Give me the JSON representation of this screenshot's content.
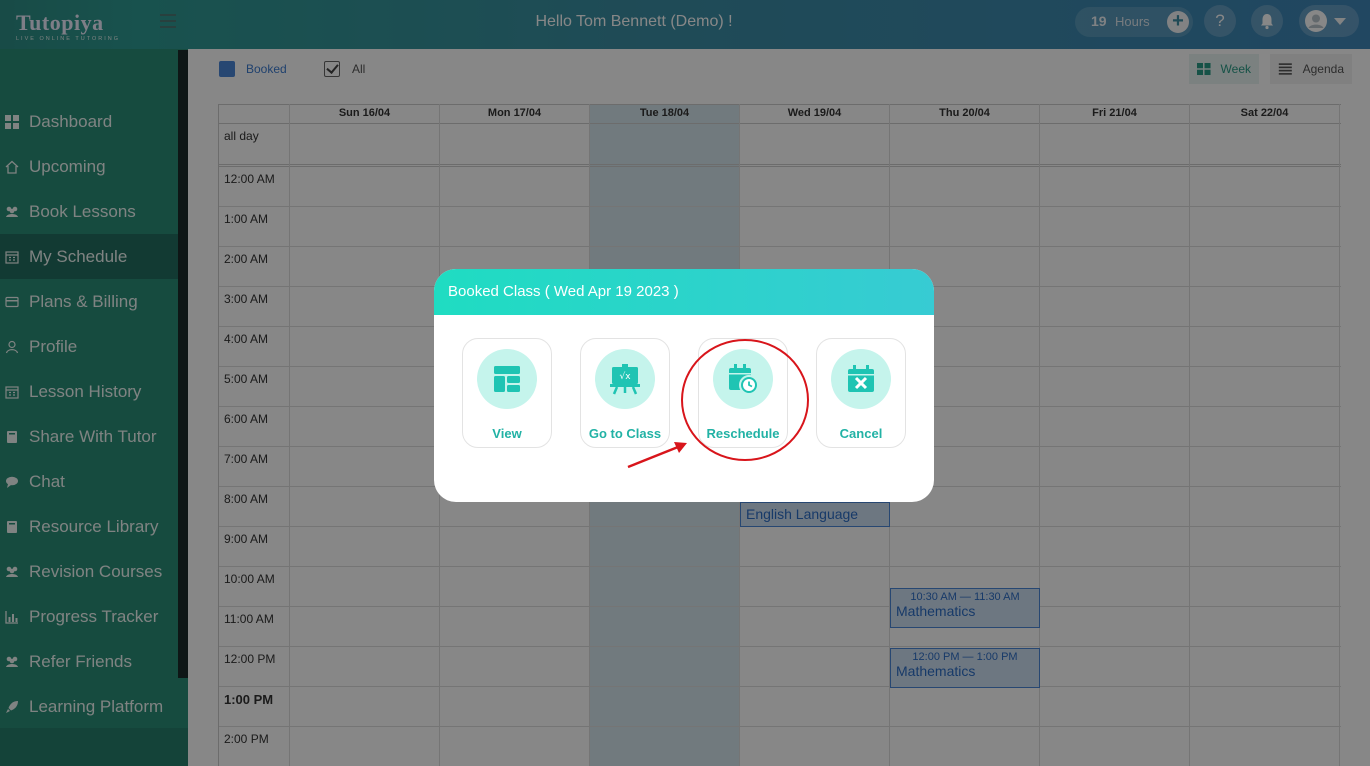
{
  "app": {
    "logo_text": "Tutopiya",
    "logo_tagline": "LIVE ONLINE TUTORING",
    "greeting": "Hello Tom Bennett (Demo) !",
    "hours_value": "19",
    "hours_label": "Hours",
    "help_label": "?"
  },
  "sidebar": {
    "items": [
      {
        "label": "Dashboard",
        "icon": "dashboard-icon"
      },
      {
        "label": "Upcoming",
        "icon": "home-icon"
      },
      {
        "label": "Book Lessons",
        "icon": "users-icon"
      },
      {
        "label": "My Schedule",
        "icon": "calendar-icon",
        "active": true
      },
      {
        "label": "Plans & Billing",
        "icon": "card-icon"
      },
      {
        "label": "Profile",
        "icon": "user-icon"
      },
      {
        "label": "Lesson History",
        "icon": "calendar-icon"
      },
      {
        "label": "Share With Tutor",
        "icon": "book-icon"
      },
      {
        "label": "Chat",
        "icon": "chat-icon"
      },
      {
        "label": "Resource Library",
        "icon": "book-icon"
      },
      {
        "label": "Revision Courses",
        "icon": "users-icon"
      },
      {
        "label": "Progress Tracker",
        "icon": "chart-icon"
      },
      {
        "label": "Refer Friends",
        "icon": "users-icon"
      },
      {
        "label": "Learning Platform",
        "icon": "rocket-icon"
      }
    ]
  },
  "toolbar": {
    "legend_booked": "Booked",
    "legend_all": "All",
    "view_week": "Week",
    "view_agenda": "Agenda"
  },
  "calendar": {
    "days": [
      "Sun 16/04",
      "Mon 17/04",
      "Tue 18/04",
      "Wed 19/04",
      "Thu 20/04",
      "Fri 21/04",
      "Sat 22/04"
    ],
    "all_day_label": "all day",
    "times": [
      "12:00 AM",
      "1:00 AM",
      "2:00 AM",
      "3:00 AM",
      "4:00 AM",
      "5:00 AM",
      "6:00 AM",
      "7:00 AM",
      "8:00 AM",
      "9:00 AM",
      "10:00 AM",
      "11:00 AM",
      "12:00 PM",
      "1:00 PM",
      "2:00 PM"
    ],
    "events": [
      {
        "title": "English Language",
        "time": ""
      },
      {
        "title": "Mathematics",
        "time": "10:30 AM — 11:30 AM"
      },
      {
        "title": "Mathematics",
        "time": "12:00 PM — 1:00 PM"
      }
    ]
  },
  "modal": {
    "title": "Booked Class ( Wed Apr 19 2023 )",
    "actions": [
      {
        "label": "View",
        "icon": "dashboard-icon"
      },
      {
        "label": "Go to Class",
        "icon": "whiteboard-icon"
      },
      {
        "label": "Reschedule",
        "icon": "calendar-clock-icon"
      },
      {
        "label": "Cancel",
        "icon": "calendar-x-icon"
      }
    ]
  },
  "colors": {
    "sidebar": "#2a8e77",
    "accent": "#22b2a5",
    "event_border": "#4a86d8",
    "highlight": "#d8151b"
  }
}
